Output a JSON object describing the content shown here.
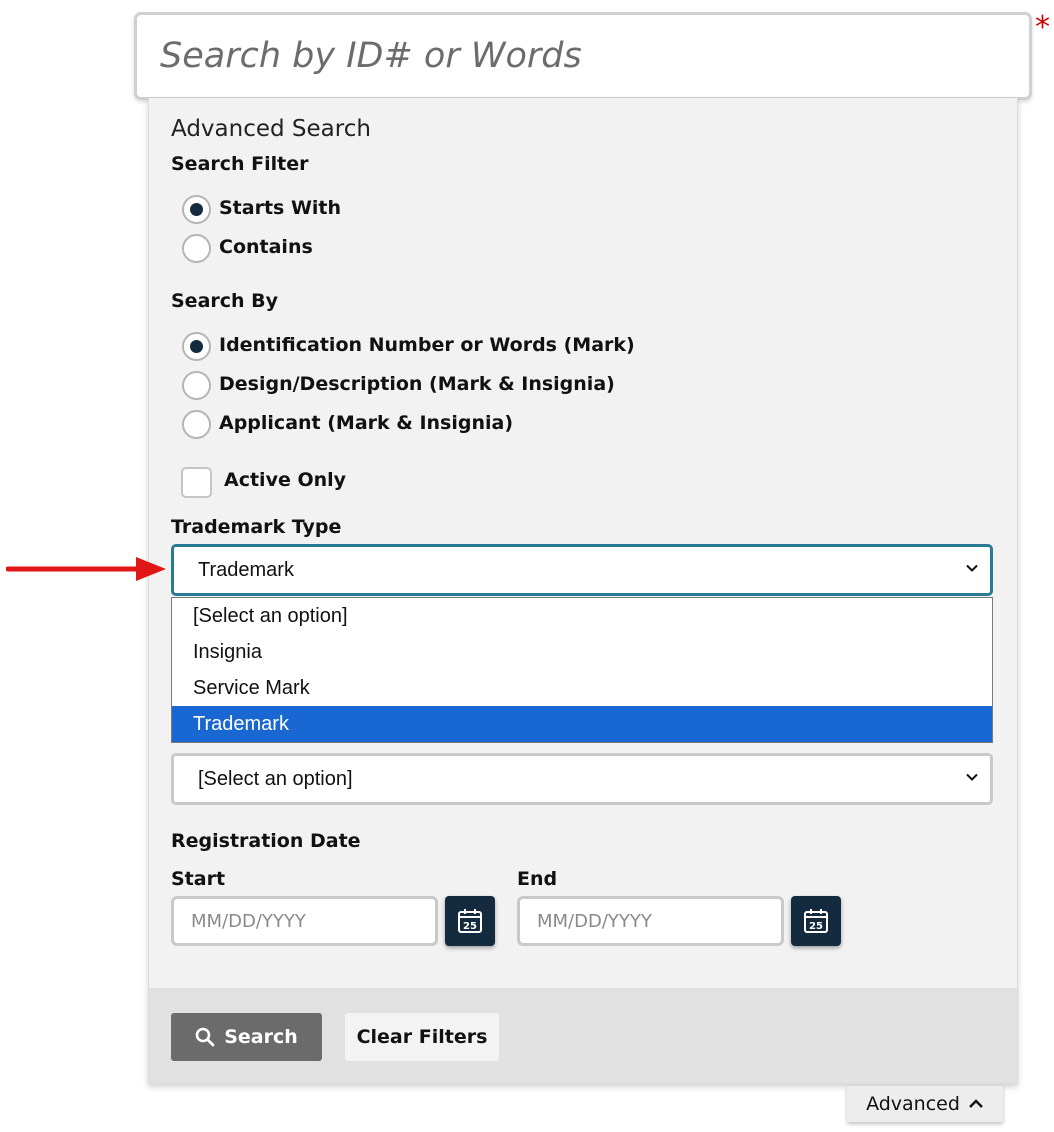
{
  "search": {
    "placeholder": "Search by ID# or Words",
    "required_marker": "*"
  },
  "advanced": {
    "title": "Advanced Search",
    "search_filter": {
      "label": "Search Filter",
      "options": [
        "Starts With",
        "Contains"
      ],
      "selected": "Starts With"
    },
    "search_by": {
      "label": "Search By",
      "options": [
        "Identification Number or Words (Mark)",
        "Design/Description (Mark & Insignia)",
        "Applicant (Mark & Insignia)"
      ],
      "selected": "Identification Number or Words (Mark)"
    },
    "active_only": {
      "label": "Active Only",
      "checked": false
    },
    "trademark_type": {
      "label": "Trademark Type",
      "value": "Trademark",
      "options": [
        "[Select an option]",
        "Insignia",
        "Service Mark",
        "Trademark"
      ],
      "highlighted": "Trademark"
    },
    "second_select": {
      "value": "[Select an option]"
    },
    "registration_date": {
      "label": "Registration Date",
      "start": {
        "label": "Start",
        "placeholder": "MM/DD/YYYY"
      },
      "end": {
        "label": "End",
        "placeholder": "MM/DD/YYYY"
      },
      "calendar_day": "25"
    },
    "buttons": {
      "search": "Search",
      "clear": "Clear Filters"
    },
    "toggle_label": "Advanced"
  },
  "colors": {
    "annotation_arrow": "#e01515",
    "selected_option": "#1967d2",
    "focus_border": "#2b7a94",
    "dark_button": "#142a3e"
  },
  "icons": [
    "search-icon",
    "calendar-icon",
    "chevron-down-icon",
    "chevron-up-icon",
    "annotation-arrow"
  ]
}
